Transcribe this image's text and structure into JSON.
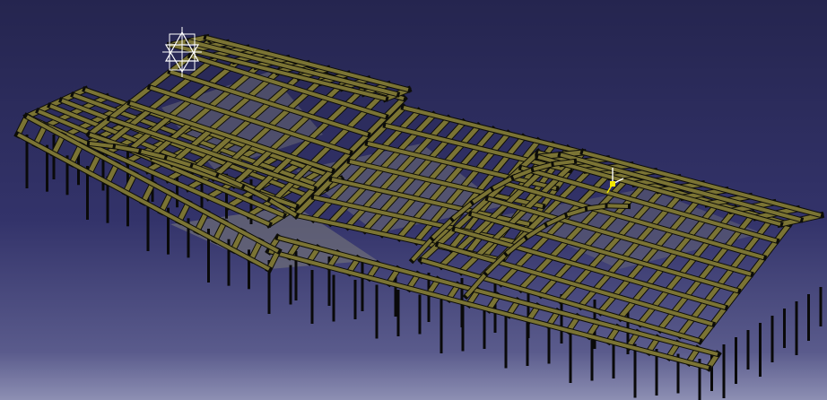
{
  "viewport": {
    "background_top": "#25254f",
    "background_bottom": "#8d8fb3"
  },
  "model": {
    "beam_color": "#7b7434",
    "beam_edge_color": "#0d0d08",
    "column_color": "#0a0a0a",
    "floor_color": "#6f6f78",
    "highlight_color": "#d0d0e8"
  },
  "compass": {
    "icon": "axis-triad-icon",
    "color": "#ffffff"
  },
  "secondary_axis": {
    "icon": "axis-system-icon",
    "color": "#ffffff",
    "accent": "#f2e600"
  }
}
